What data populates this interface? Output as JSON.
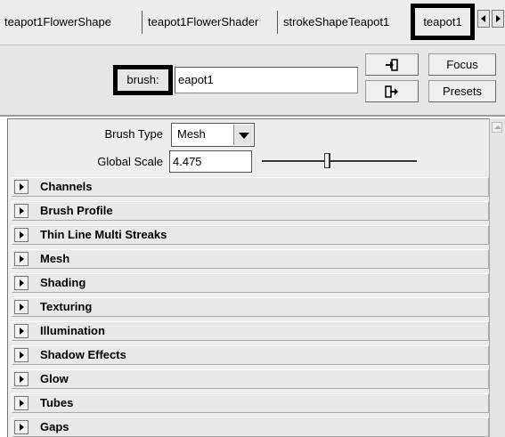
{
  "tabs": [
    {
      "label": "teapot1FlowerShape",
      "active": false
    },
    {
      "label": "teapot1FlowerShader",
      "active": false
    },
    {
      "label": "strokeShapeTeapot1",
      "active": false
    },
    {
      "label": "teapot1",
      "active": true
    }
  ],
  "header": {
    "brush_label": "brush:",
    "brush_value": "eapot1",
    "focus_label": "Focus",
    "presets_label": "Presets",
    "icons": [
      "load-attributes-icon",
      "copy-tab-icon"
    ]
  },
  "attributes": {
    "brush_type_label": "Brush Type",
    "brush_type_value": "Mesh",
    "global_scale_label": "Global Scale",
    "global_scale_value": "4.475",
    "global_scale_slider_fraction": 0.42
  },
  "sections": [
    {
      "label": "Channels"
    },
    {
      "label": "Brush Profile"
    },
    {
      "label": "Thin Line Multi Streaks"
    },
    {
      "label": "Mesh"
    },
    {
      "label": "Shading"
    },
    {
      "label": "Texturing"
    },
    {
      "label": "Illumination"
    },
    {
      "label": "Shadow Effects"
    },
    {
      "label": "Glow"
    },
    {
      "label": "Tubes"
    },
    {
      "label": "Gaps"
    }
  ]
}
